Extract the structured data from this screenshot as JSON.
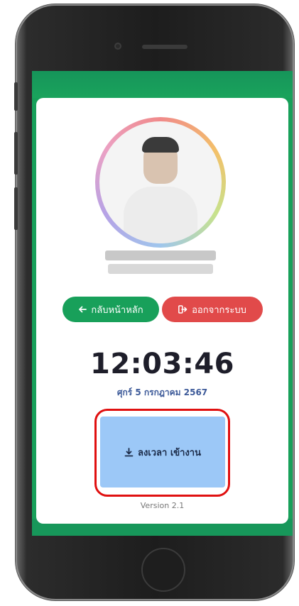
{
  "app": {
    "accent_color": "#18a05a",
    "danger_color": "#e14a4a",
    "clockin_color": "#9cc8f7",
    "highlight_color": "#e01010"
  },
  "profile": {
    "name_redacted": true
  },
  "nav": {
    "home_label": "กลับหน้าหลัก",
    "home_icon": "arrow-left-icon",
    "logout_label": "ออกจากระบบ",
    "logout_icon": "sign-out-icon"
  },
  "clock": {
    "time": "12:03:46",
    "date": "ศุกร์ 5 กรกฎาคม 2567"
  },
  "clockin": {
    "label": "ลงเวลา เข้างาน",
    "icon": "download-icon"
  },
  "footer": {
    "version": "Version 2.1"
  }
}
